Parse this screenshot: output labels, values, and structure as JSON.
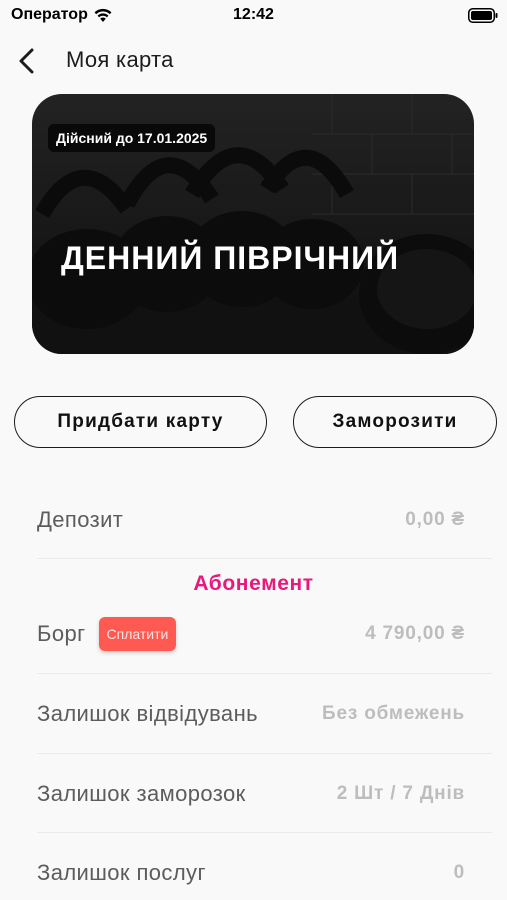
{
  "status_bar": {
    "carrier": "Оператор",
    "time": "12:42"
  },
  "header": {
    "title": "Моя карта"
  },
  "card": {
    "valid_until": "Дійсний до 17.01.2025",
    "plan_name": "ДЕННИЙ ПІВРІЧНИЙ"
  },
  "actions": {
    "buy_label": "Придбати карту",
    "freeze_label": "Заморозити"
  },
  "deposit": {
    "label": "Депозит",
    "value": "0,00 ₴"
  },
  "subscription": {
    "heading": "Абонемент",
    "debt": {
      "label": "Борг",
      "pay_label": "Сплатити",
      "value": "4 790,00 ₴"
    },
    "visits": {
      "label": "Залишок відвідувань",
      "value": "Без обмежень"
    },
    "freezes": {
      "label": "Залишок заморозок",
      "value": "2 Шт / 7 Днів"
    },
    "services": {
      "label": "Залишок послуг",
      "value": "0"
    }
  },
  "colors": {
    "accent": "#e8197d",
    "pay_button": "#ff5a52",
    "background": "#f9f9f9"
  },
  "icons": {
    "back": "chevron-left-icon",
    "wifi": "wifi-icon",
    "battery": "battery-icon"
  }
}
